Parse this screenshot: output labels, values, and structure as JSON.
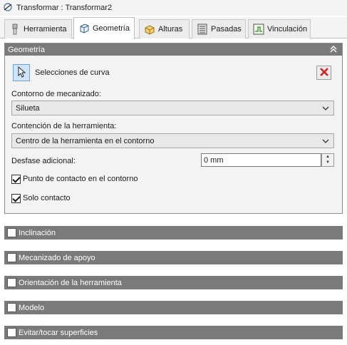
{
  "window": {
    "title": "Transformar : Transformar2"
  },
  "tabs": [
    {
      "label": "Herramienta",
      "icon": "tool-icon"
    },
    {
      "label": "Geometría",
      "icon": "geometry-cube-icon"
    },
    {
      "label": "Alturas",
      "icon": "heights-icon"
    },
    {
      "label": "Pasadas",
      "icon": "passes-icon"
    },
    {
      "label": "Vinculación",
      "icon": "linking-icon"
    }
  ],
  "geometry": {
    "header": "Geometría",
    "curve_selection_label": "Selecciones de curva",
    "machining_contour_label": "Contorno de mecanizado:",
    "machining_contour_value": "Silueta",
    "tool_containment_label": "Contención de la herramienta:",
    "tool_containment_value": "Centro de la herramienta en el contorno",
    "additional_offset_label": "Desfase adicional:",
    "additional_offset_value": "0 mm",
    "contact_point_label": "Punto de contacto en el contorno",
    "contact_point_checked": true,
    "contact_only_label": "Solo contacto",
    "contact_only_checked": true
  },
  "sections": [
    {
      "label": "Inclinación",
      "checked": false
    },
    {
      "label": "Mecanizado de apoyo",
      "checked": false
    },
    {
      "label": "Orientación de la herramienta",
      "checked": false
    },
    {
      "label": "Modelo",
      "checked": false
    },
    {
      "label": "Evitar/tocar superficies",
      "checked": false
    }
  ],
  "colors": {
    "section_header": "#7a7a7a",
    "selected_button": "#cfe4fa",
    "delete_red": "#d62020"
  }
}
